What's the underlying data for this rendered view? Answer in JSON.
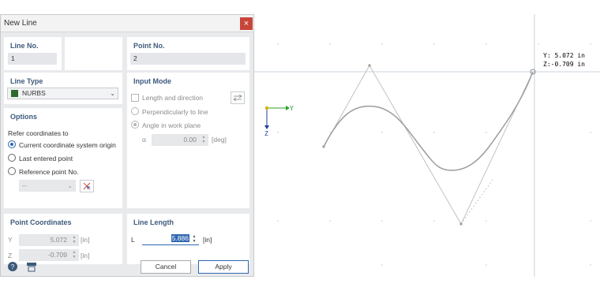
{
  "dialog": {
    "title": "New Line",
    "close_glyph": "×"
  },
  "line_no": {
    "label": "Line No.",
    "value": "1"
  },
  "point_no": {
    "label": "Point No.",
    "value": "2"
  },
  "line_type": {
    "label": "Line Type",
    "value": "NURBS",
    "swatch_color": "#2d6b2d"
  },
  "input_mode": {
    "label": "Input Mode",
    "length_direction": "Length and direction",
    "perpendicular": "Perpendicularly to line",
    "angle_work_plane": "Angle in work plane",
    "alpha_symbol": "α",
    "alpha_value": "0.00",
    "alpha_unit": "[deg]"
  },
  "options": {
    "label": "Options",
    "refer_text": "Refer coordinates to",
    "current_origin": "Current coordinate system origin",
    "last_point": "Last entered point",
    "reference_point": "Reference point No.",
    "ref_select_value": "--"
  },
  "point_coords": {
    "label": "Point Coordinates",
    "y_label": "Y",
    "y_value": "5.072",
    "y_unit": "[in]",
    "z_label": "Z",
    "z_value": "-0.709",
    "z_unit": "[in]"
  },
  "line_length": {
    "label": "Line Length",
    "l_label": "L",
    "l_value": "5.886",
    "l_unit": "[in]"
  },
  "buttons": {
    "cancel": "Cancel",
    "apply": "Apply"
  },
  "viewport": {
    "coord_y": "Y: 5.072 in",
    "coord_z": "Z:-0.709 in",
    "axis_y": "Y",
    "axis_z": "Z",
    "axis_y_color": "#2ea02e",
    "axis_z_color": "#1f3d99",
    "origin_color": "#e0b000"
  }
}
